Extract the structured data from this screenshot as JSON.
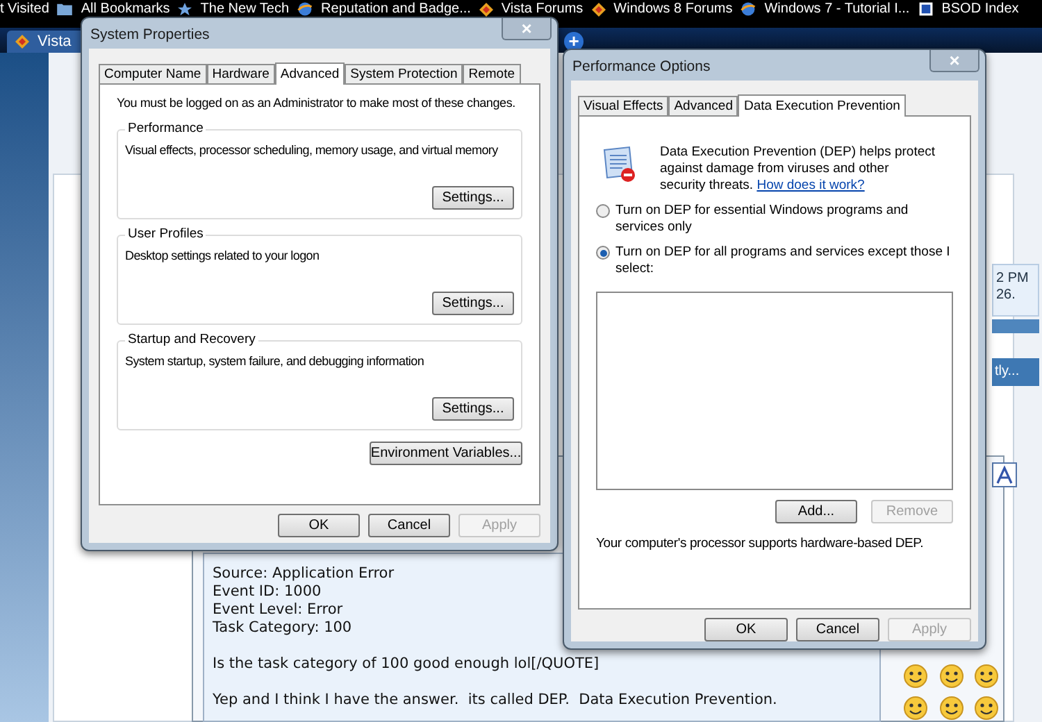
{
  "bookmarks_bar": [
    {
      "label": "t Visited"
    },
    {
      "label": "All Bookmarks"
    },
    {
      "label": "The New Tech"
    },
    {
      "label": "Reputation and Badge..."
    },
    {
      "label": "Vista Forums"
    },
    {
      "label": "Windows 8 Forums"
    },
    {
      "label": "Windows 7 - Tutorial I..."
    },
    {
      "label": "BSOD Index"
    }
  ],
  "browser_tabs": [
    {
      "label": "Vista",
      "selected": true
    }
  ],
  "new_tab_button": "+",
  "page": {
    "side_fragments": [
      "2 PM",
      "26."
    ],
    "bar_fragment": "tly...",
    "post_paragraphs": [
      [
        "Source: Application Error",
        "Event ID: 1000",
        "Event Level: Error",
        "Task Category: 100"
      ],
      [
        "Is the task category of 100 good enough lol[/QUOTE]"
      ],
      [
        "Yep and I think I have the answer.  its called DEP.  Data Execution Prevention."
      ]
    ]
  },
  "system_properties": {
    "title": "System Properties",
    "close": "×",
    "tabs": [
      {
        "label": "Computer Name",
        "selected": false
      },
      {
        "label": "Hardware",
        "selected": false
      },
      {
        "label": "Advanced",
        "selected": true
      },
      {
        "label": "System Protection",
        "selected": false
      },
      {
        "label": "Remote",
        "selected": false
      }
    ],
    "notice": "You must be logged on as an Administrator to make most of these changes.",
    "groups": [
      {
        "title": "Performance",
        "description": "Visual effects, processor scheduling, memory usage, and virtual memory",
        "button": "Settings..."
      },
      {
        "title": "User Profiles",
        "description": "Desktop settings related to your logon",
        "button": "Settings..."
      },
      {
        "title": "Startup and Recovery",
        "description": "System startup, system failure, and debugging information",
        "button": "Settings..."
      }
    ],
    "extra_button": "Environment Variables...",
    "buttons": [
      {
        "label": "OK",
        "disabled": false
      },
      {
        "label": "Cancel",
        "disabled": false
      },
      {
        "label": "Apply",
        "disabled": true
      }
    ]
  },
  "performance_options": {
    "title": "Performance Options",
    "close": "×",
    "tabs": [
      {
        "label": "Visual Effects",
        "selected": false
      },
      {
        "label": "Advanced",
        "selected": false
      },
      {
        "label": "Data Execution Prevention",
        "selected": true
      }
    ],
    "intro": "Data Execution Prevention (DEP) helps protect against damage from viruses and other security threats.",
    "link": "How does it work?",
    "options": [
      {
        "label": "Turn on DEP for essential Windows programs and services only",
        "selected": false
      },
      {
        "label": "Turn on DEP for all programs and services except those I select:",
        "selected": true
      }
    ],
    "list_buttons": [
      {
        "label": "Add...",
        "disabled": false
      },
      {
        "label": "Remove",
        "disabled": true
      }
    ],
    "status": "Your computer's processor supports hardware-based DEP.",
    "buttons": [
      {
        "label": "OK",
        "disabled": false
      },
      {
        "label": "Cancel",
        "disabled": false
      },
      {
        "label": "Apply",
        "disabled": true
      }
    ]
  }
}
